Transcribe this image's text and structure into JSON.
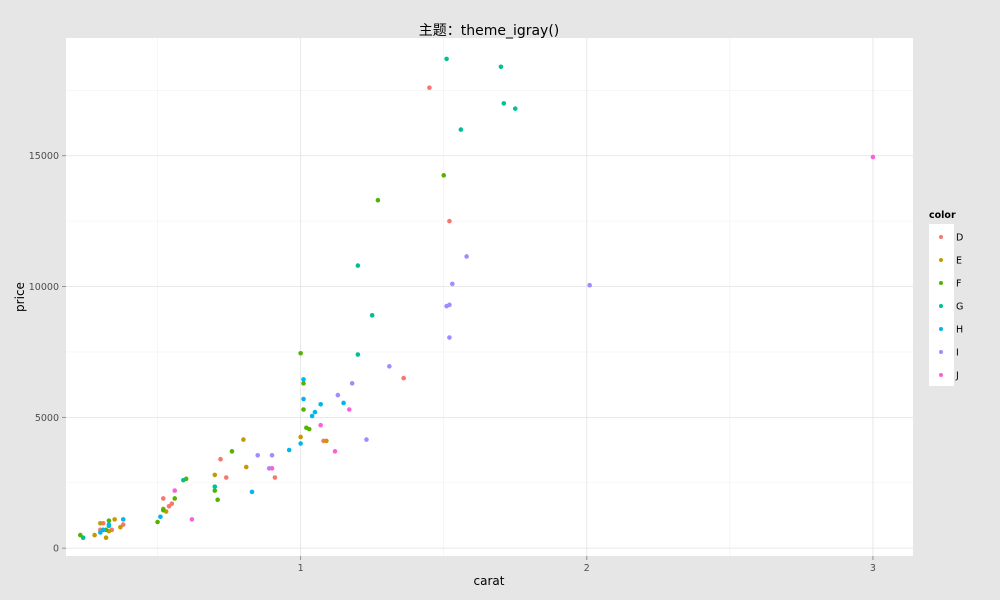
{
  "chart_data": {
    "type": "scatter",
    "title": "主题：theme_igray()",
    "xlabel": "carat",
    "ylabel": "price",
    "xlim": [
      0.18,
      3.14
    ],
    "ylim": [
      -300,
      19500
    ],
    "x_ticks": [
      1,
      2,
      3
    ],
    "y_ticks": [
      0,
      5000,
      10000,
      15000
    ],
    "grid": true,
    "legend": {
      "title": "color",
      "position": "right",
      "entries": [
        "D",
        "E",
        "F",
        "G",
        "H",
        "I",
        "J"
      ]
    },
    "colors": {
      "D": "#F8766D",
      "E": "#C49A00",
      "F": "#53B400",
      "G": "#00C094",
      "H": "#00B6EB",
      "I": "#A58AFF",
      "J": "#FB61D7"
    },
    "series": [
      {
        "name": "D",
        "points": [
          [
            0.3,
            700
          ],
          [
            0.31,
            950
          ],
          [
            0.34,
            700
          ],
          [
            0.38,
            900
          ],
          [
            0.52,
            1900
          ],
          [
            0.54,
            1600
          ],
          [
            0.55,
            1700
          ],
          [
            0.72,
            3400
          ],
          [
            0.74,
            2700
          ],
          [
            0.91,
            2700
          ],
          [
            1.08,
            4100
          ],
          [
            1.36,
            6500
          ],
          [
            1.45,
            17600
          ],
          [
            1.52,
            12500
          ]
        ]
      },
      {
        "name": "E",
        "points": [
          [
            0.28,
            500
          ],
          [
            0.3,
            950
          ],
          [
            0.32,
            400
          ],
          [
            0.33,
            650
          ],
          [
            0.35,
            1100
          ],
          [
            0.37,
            800
          ],
          [
            0.52,
            1500
          ],
          [
            0.53,
            1400
          ],
          [
            0.7,
            2800
          ],
          [
            0.8,
            4150
          ],
          [
            0.81,
            3100
          ],
          [
            1.0,
            4250
          ],
          [
            1.09,
            4100
          ]
        ]
      },
      {
        "name": "F",
        "points": [
          [
            0.23,
            500
          ],
          [
            0.32,
            700
          ],
          [
            0.33,
            1050
          ],
          [
            0.5,
            1000
          ],
          [
            0.52,
            1450
          ],
          [
            0.56,
            1900
          ],
          [
            0.6,
            2650
          ],
          [
            0.7,
            2200
          ],
          [
            0.71,
            1850
          ],
          [
            0.76,
            3700
          ],
          [
            1.0,
            7450
          ],
          [
            1.01,
            6300
          ],
          [
            1.01,
            5300
          ],
          [
            1.02,
            4600
          ],
          [
            1.03,
            4550
          ],
          [
            1.27,
            13300
          ],
          [
            1.5,
            14250
          ]
        ]
      },
      {
        "name": "G",
        "points": [
          [
            0.24,
            400
          ],
          [
            0.33,
            850
          ],
          [
            0.59,
            2600
          ],
          [
            0.7,
            2350
          ],
          [
            1.2,
            7400
          ],
          [
            1.2,
            10800
          ],
          [
            1.25,
            8900
          ],
          [
            1.51,
            18700
          ],
          [
            1.56,
            16000
          ],
          [
            1.7,
            18400
          ],
          [
            1.71,
            17000
          ],
          [
            1.75,
            16800
          ]
        ]
      },
      {
        "name": "H",
        "points": [
          [
            0.3,
            600
          ],
          [
            0.31,
            700
          ],
          [
            0.33,
            900
          ],
          [
            0.38,
            1100
          ],
          [
            0.51,
            1200
          ],
          [
            0.83,
            2150
          ],
          [
            0.96,
            3750
          ],
          [
            1.0,
            4000
          ],
          [
            1.01,
            6450
          ],
          [
            1.01,
            5700
          ],
          [
            1.04,
            5050
          ],
          [
            1.05,
            5200
          ],
          [
            1.07,
            5500
          ],
          [
            1.15,
            5550
          ]
        ]
      },
      {
        "name": "I",
        "points": [
          [
            0.85,
            3550
          ],
          [
            0.89,
            3050
          ],
          [
            0.9,
            3550
          ],
          [
            1.13,
            5850
          ],
          [
            1.18,
            6300
          ],
          [
            1.23,
            4150
          ],
          [
            1.31,
            6950
          ],
          [
            1.51,
            9250
          ],
          [
            1.52,
            9300
          ],
          [
            1.52,
            8050
          ],
          [
            1.53,
            10100
          ],
          [
            1.58,
            11150
          ],
          [
            2.01,
            10050
          ]
        ]
      },
      {
        "name": "J",
        "points": [
          [
            0.56,
            2200
          ],
          [
            0.62,
            1100
          ],
          [
            0.9,
            3050
          ],
          [
            1.07,
            4700
          ],
          [
            1.12,
            3700
          ],
          [
            1.17,
            5300
          ],
          [
            3.0,
            14950
          ]
        ]
      }
    ]
  }
}
